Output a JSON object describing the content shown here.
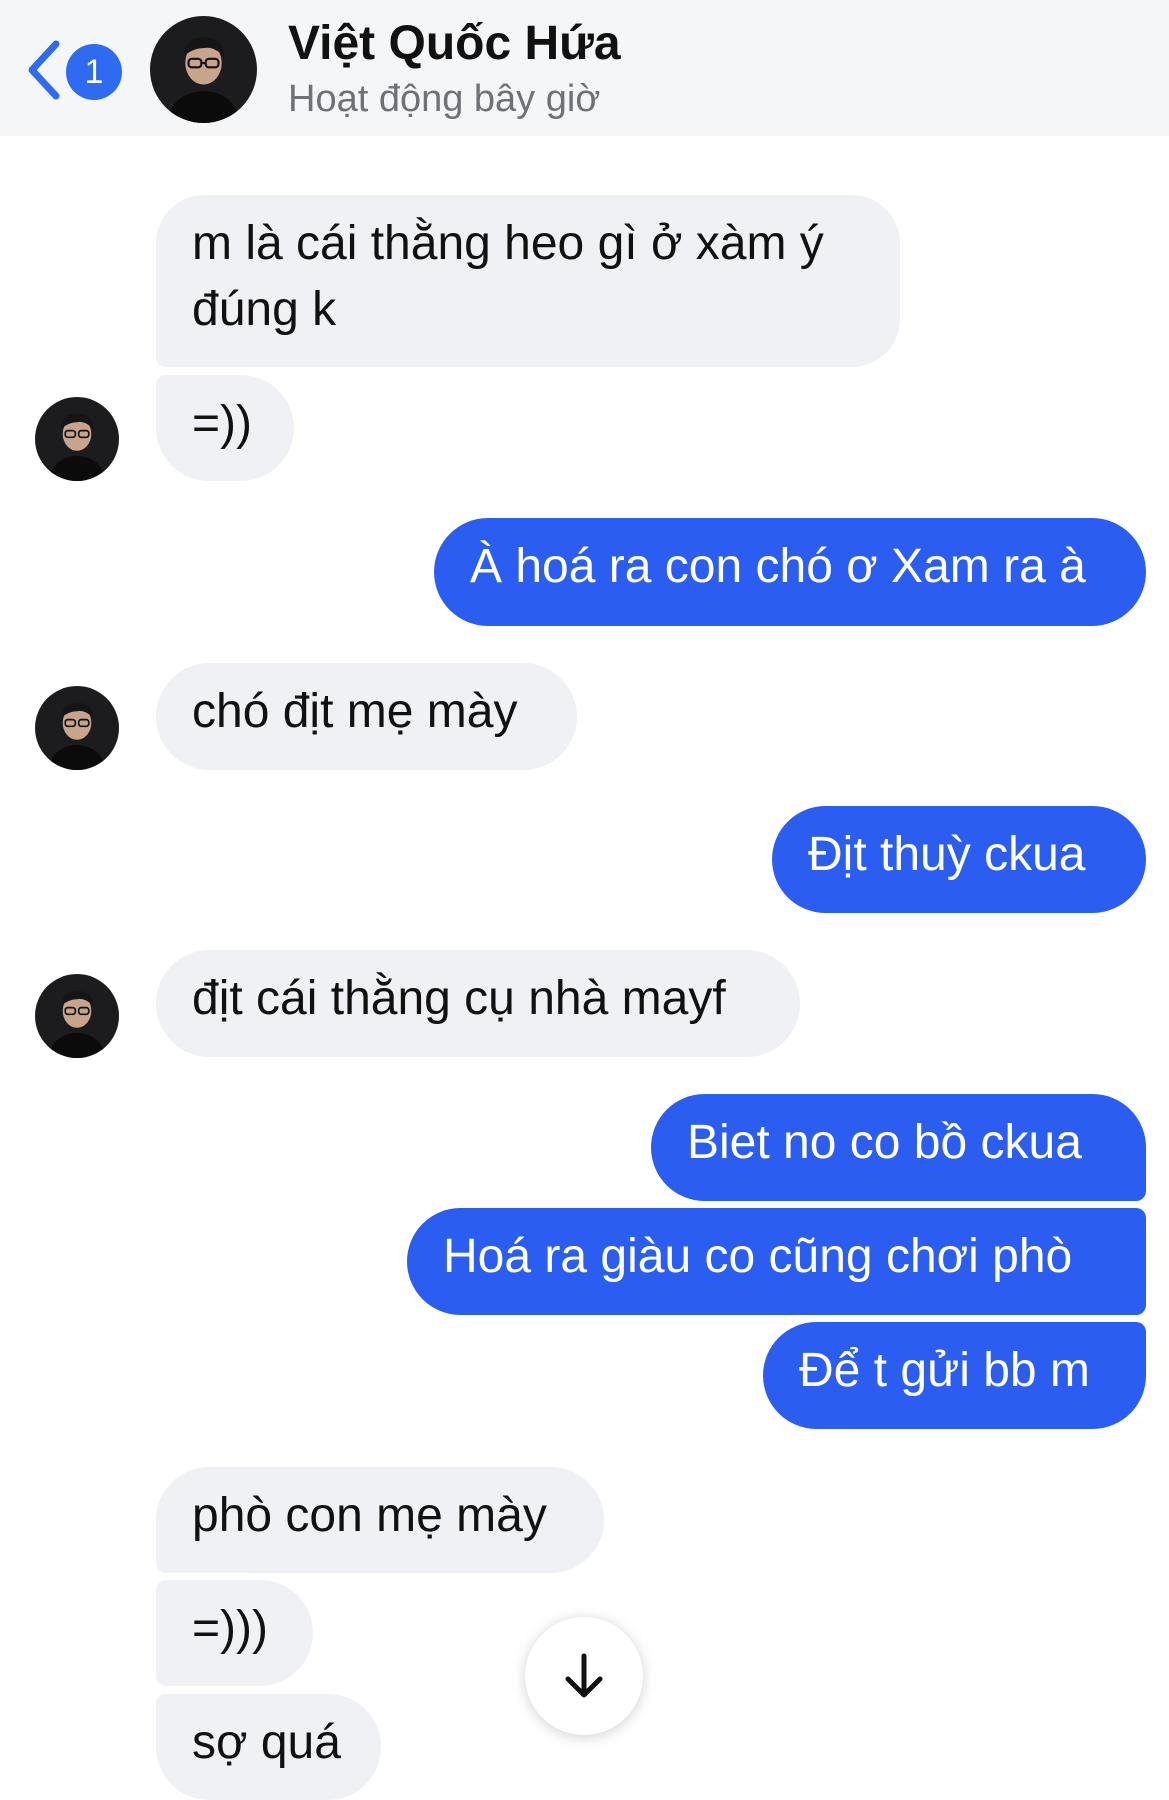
{
  "header": {
    "back_badge": "1",
    "contact_name": "Việt Quốc Hứa",
    "status": "Hoạt động bây giờ"
  },
  "messages": [
    {
      "from": "them",
      "text": "m là cái thằng heo gì ở xàm ý"
    },
    {
      "from": "them",
      "text": "đúng k"
    },
    {
      "from": "them",
      "text": "=))"
    },
    {
      "from": "me",
      "text": "À hoá ra con chó ơ Xam ra à"
    },
    {
      "from": "them",
      "text": "chó địt mẹ mày"
    },
    {
      "from": "me",
      "text": "Địt thuỳ ckua"
    },
    {
      "from": "them",
      "text": "địt cái thằng cụ nhà mayf"
    },
    {
      "from": "me",
      "text": "Biet no co bồ ckua"
    },
    {
      "from": "me",
      "text": "Hoá ra giàu co cũng chơi phò"
    },
    {
      "from": "me",
      "text": "Để t gửi bb m"
    },
    {
      "from": "them",
      "text": "phò con mẹ mày"
    },
    {
      "from": "them",
      "text": "=)))"
    },
    {
      "from": "them",
      "text": "sợ quá"
    }
  ],
  "icons": {
    "back": "chevron-left-icon",
    "scroll": "arrow-down-icon"
  },
  "colors": {
    "outgoing_bubble": "#2b5ef0",
    "incoming_bubble": "#f0f1f4",
    "accent": "#2f6bf0"
  }
}
